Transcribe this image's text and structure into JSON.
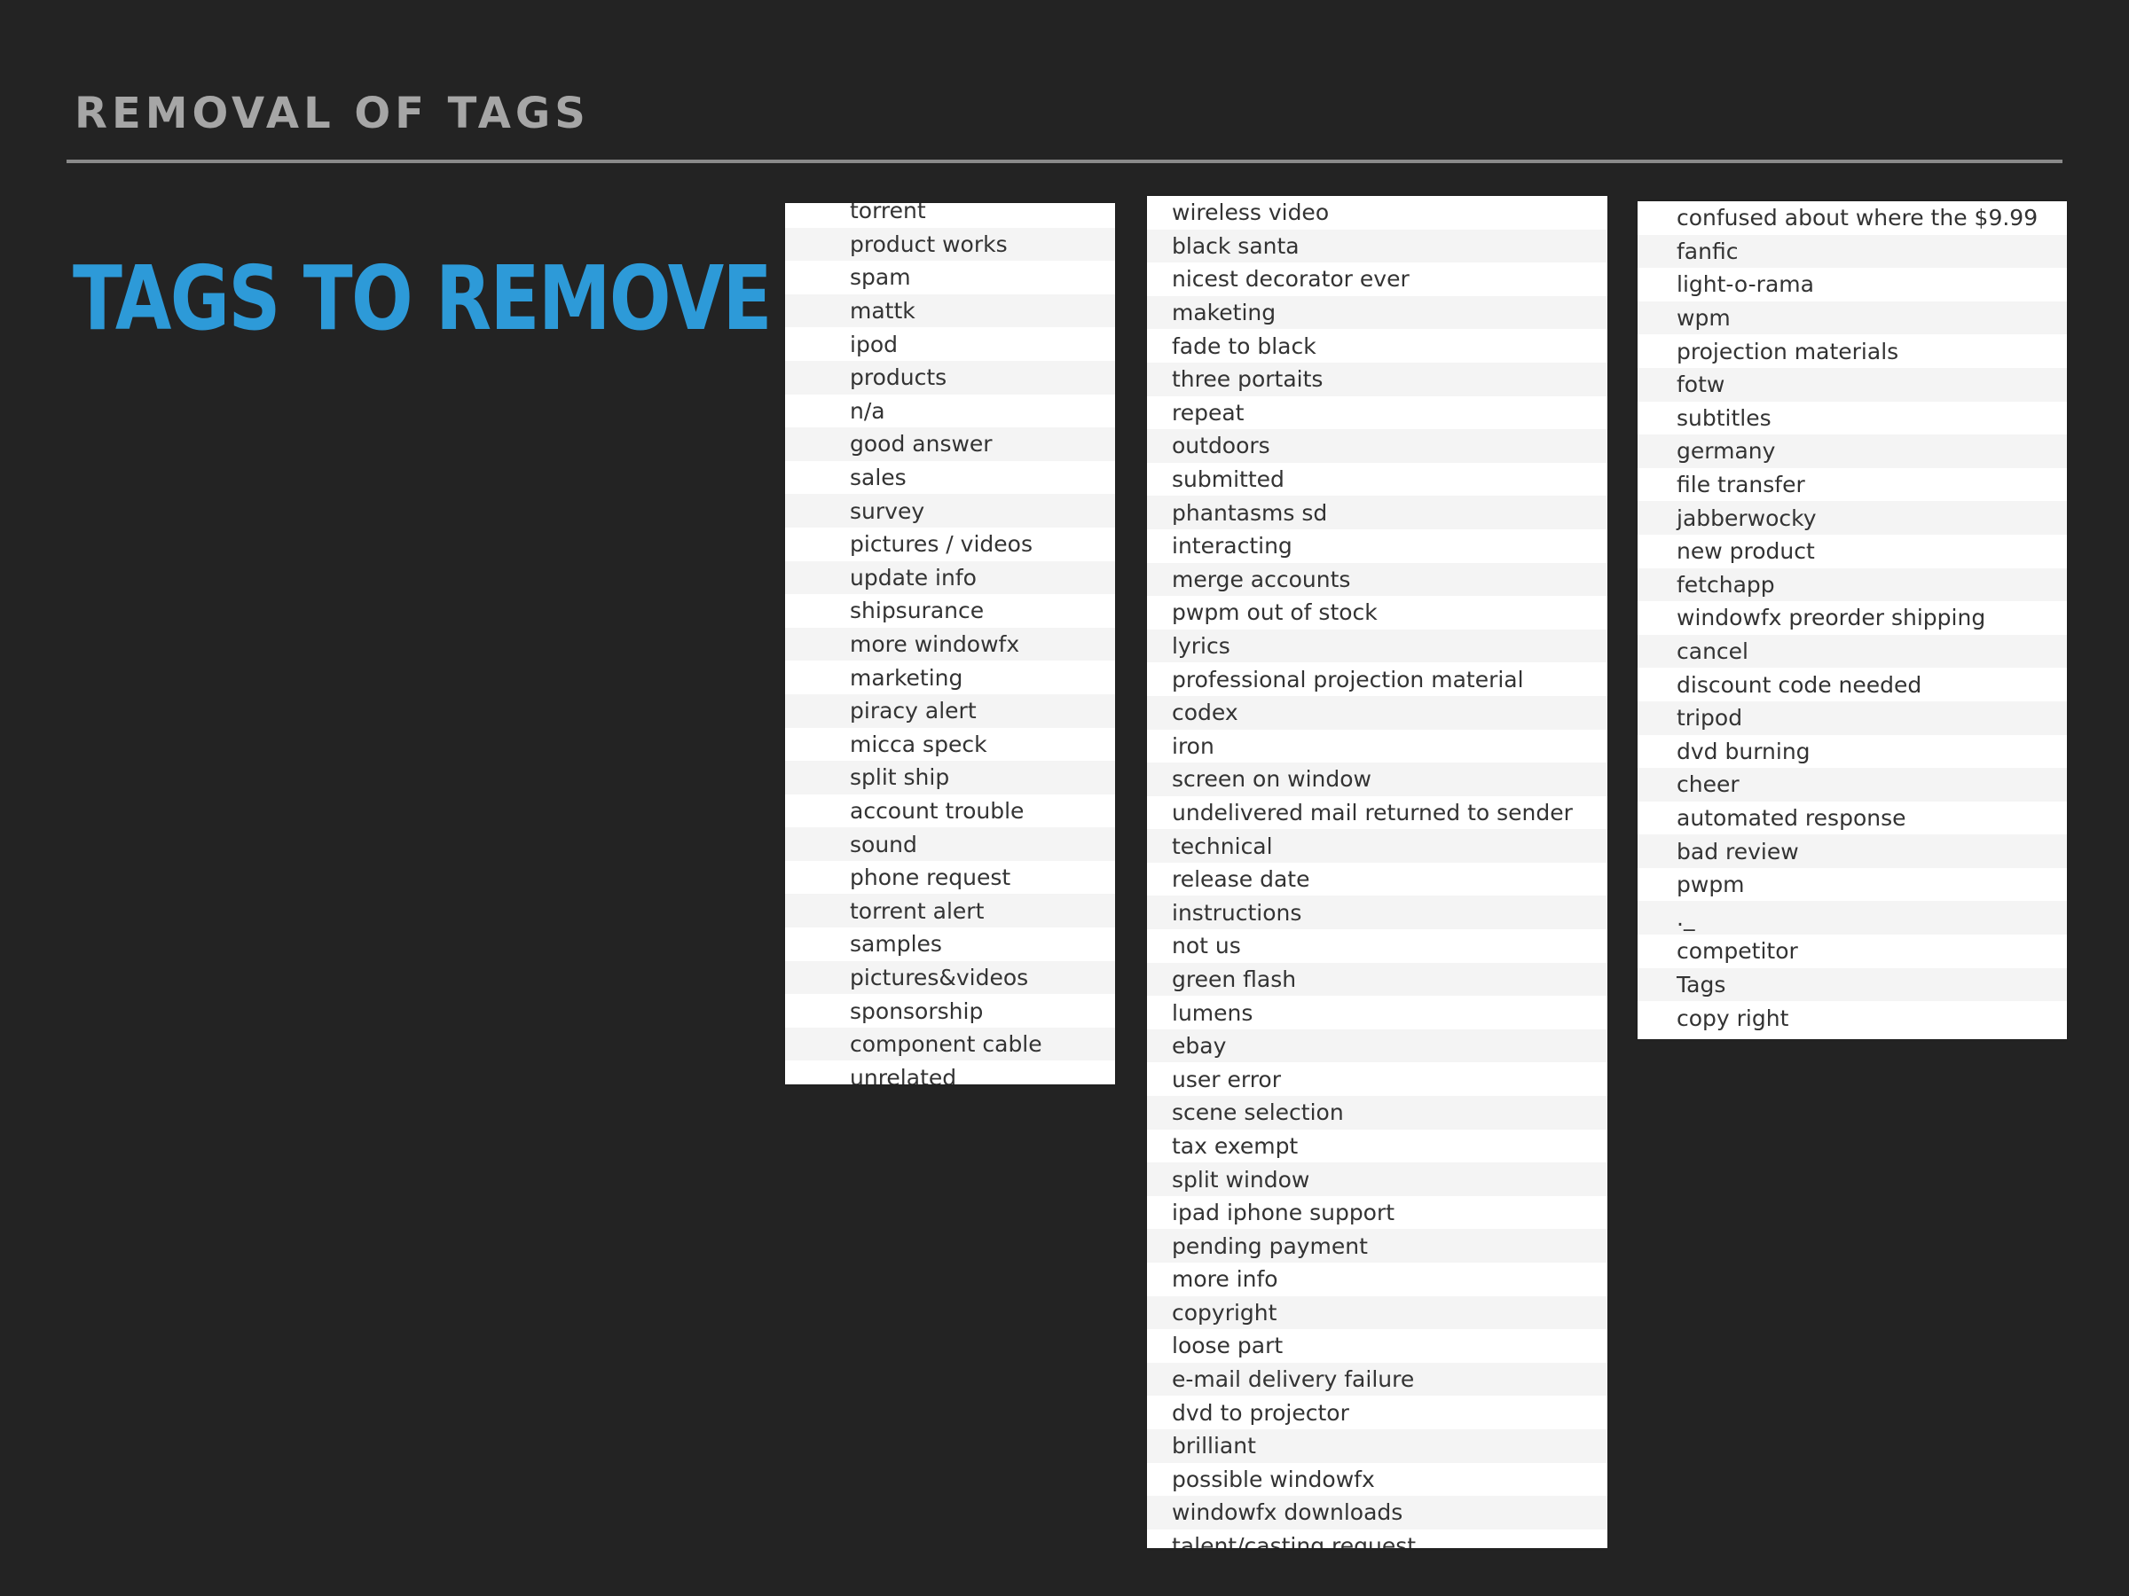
{
  "slide": {
    "header": "REMOVAL OF TAGS",
    "title": "TAGS TO REMOVE"
  },
  "colors": {
    "background": "#232323",
    "header_text": "#a6a6a6",
    "rule": "#8a8a8a",
    "title_accent": "#2d9ad8",
    "list_background": "#ffffff",
    "list_stripe": "#f4f4f4",
    "list_text": "#333333"
  },
  "lists": [
    {
      "tags": [
        "torrent",
        "product works",
        "spam",
        "mattk",
        "ipod",
        "products",
        "n/a",
        "good answer",
        "sales",
        "survey",
        "pictures / videos",
        "update info",
        "shipsurance",
        "more windowfx",
        "marketing",
        "piracy alert",
        "micca speck",
        "split ship",
        "account trouble",
        "sound",
        "phone request",
        "torrent alert",
        "samples",
        "pictures&videos",
        "sponsorship",
        "component cable",
        "unrelated"
      ]
    },
    {
      "tags": [
        "wireless video",
        "black santa",
        "nicest decorator ever",
        "maketing",
        "fade to black",
        "three portaits",
        "repeat",
        "outdoors",
        "submitted",
        "phantasms sd",
        "interacting",
        "merge accounts",
        "pwpm out of stock",
        "lyrics",
        "professional projection material",
        "codex",
        "iron",
        "screen on window",
        "undelivered mail returned to sender",
        "technical",
        "release date",
        "instructions",
        "not us",
        "green flash",
        "lumens",
        "ebay",
        "user error",
        "scene selection",
        "tax exempt",
        "split window",
        "ipad iphone support",
        "pending payment",
        "more info",
        "copyright",
        "loose part",
        "e-mail delivery failure",
        "dvd to projector",
        "brilliant",
        "possible windowfx",
        "windowfx downloads",
        "talent/casting request"
      ]
    },
    {
      "tags": [
        "confused about where the $9.99",
        "fanfic",
        "light-o-rama",
        "wpm",
        "projection materials",
        "fotw",
        "subtitles",
        "germany",
        "file transfer",
        "jabberwocky",
        "new product",
        "fetchapp",
        "windowfx preorder shipping",
        "cancel",
        "discount code needed",
        "tripod",
        "dvd burning",
        "cheer",
        "automated response",
        "bad review",
        "pwpm",
        "._",
        "competitor",
        "Tags",
        "copy right"
      ]
    }
  ]
}
